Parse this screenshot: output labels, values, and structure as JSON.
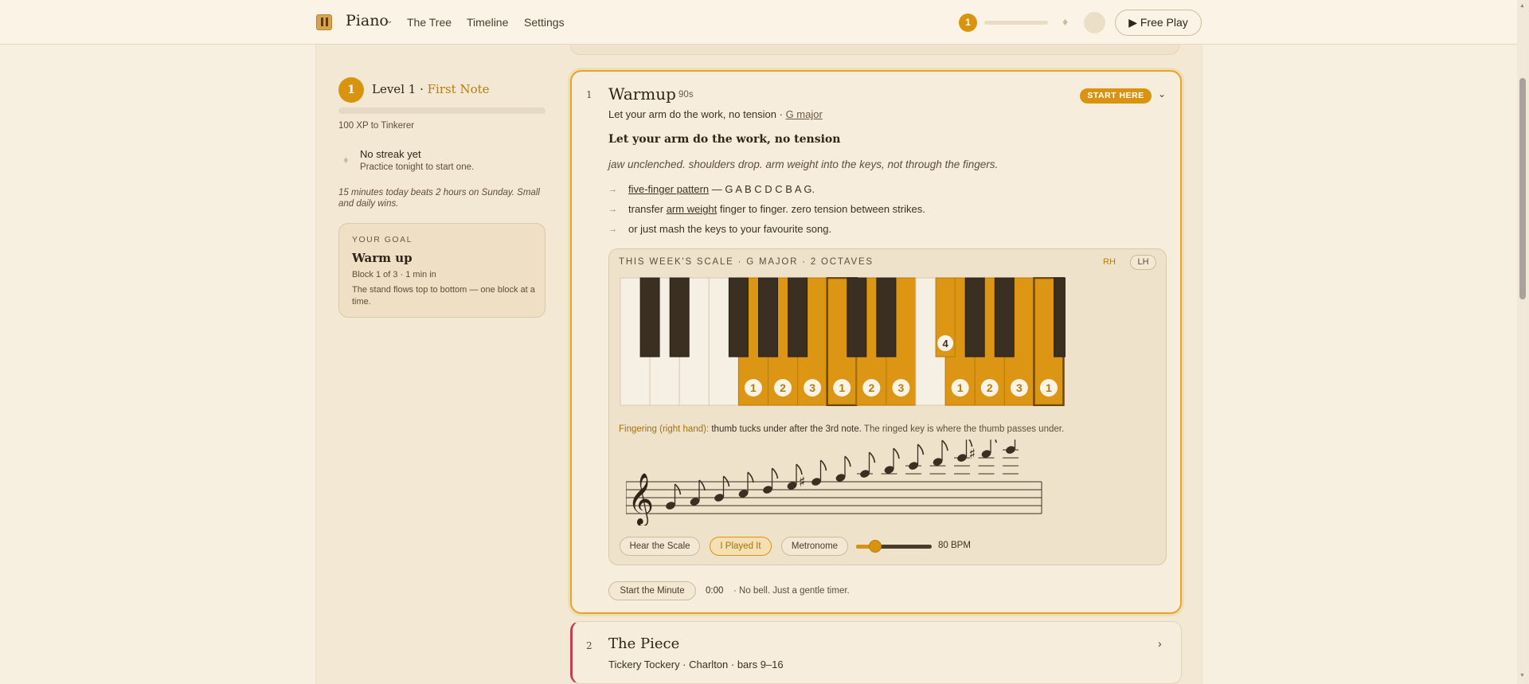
{
  "topbar": {
    "brand": "Piano",
    "nav": [
      "The Tree",
      "Timeline",
      "Settings"
    ],
    "xp_level": "1",
    "xp_progress": 0,
    "free_play_label": "▶ Free Play"
  },
  "sidebar": {
    "level_number": "1",
    "level_text": "Level 1 · ",
    "level_name": "First Note",
    "level_progress": 0,
    "xp_to_next": "100 XP to Tinkerer",
    "streak_title": "No streak yet",
    "streak_sub": "Practice tonight to start one.",
    "tip": "15 minutes today beats 2 hours on Sunday. Small and daily wins.",
    "goal": {
      "label": "YOUR GOAL",
      "title": "Warm up",
      "meta": "Block 1 of 3 · 1 min in",
      "desc": "The stand flows top to bottom — one block at a time."
    }
  },
  "warmup": {
    "num": "1",
    "title": "Warmup",
    "duration": "· 90s",
    "badge": "START HERE",
    "sub_text": "Let your arm do the work, no tension  · ",
    "sub_key": "G major",
    "cue": "Let your arm do the work, no tension",
    "cue_italic": "jaw unclenched. shoulders drop. arm weight into the keys, not through the fingers.",
    "bullets": [
      {
        "u": "five-finger pattern",
        "rest": " — G A B C D C B A G."
      },
      {
        "pre": "transfer ",
        "u": "arm weight",
        "rest": " finger to finger. zero tension between strikes."
      },
      {
        "pre": "or just mash the keys to your favourite song."
      }
    ],
    "scale": {
      "label": "THIS WEEK'S SCALE · G MAJOR · 2 OCTAVES",
      "rh": "RH",
      "lh": "LH",
      "keys": [
        {
          "hl": false,
          "ring": false,
          "finger": ""
        },
        {
          "hl": false,
          "ring": false,
          "finger": ""
        },
        {
          "hl": false,
          "ring": false,
          "finger": ""
        },
        {
          "hl": false,
          "ring": false,
          "finger": ""
        },
        {
          "hl": true,
          "ring": false,
          "finger": "1"
        },
        {
          "hl": true,
          "ring": false,
          "finger": "2"
        },
        {
          "hl": true,
          "ring": false,
          "finger": "3"
        },
        {
          "hl": true,
          "ring": true,
          "finger": "1"
        },
        {
          "hl": true,
          "ring": false,
          "finger": "2"
        },
        {
          "hl": true,
          "ring": false,
          "finger": "3"
        },
        {
          "hl": false,
          "ring": false,
          "finger": ""
        },
        {
          "hl": true,
          "ring": false,
          "finger": "1"
        },
        {
          "hl": true,
          "ring": false,
          "finger": "2"
        },
        {
          "hl": true,
          "ring": false,
          "finger": "3"
        },
        {
          "hl": true,
          "ring": true,
          "finger": "1"
        }
      ],
      "sharp_finger": "4",
      "fingering_label": "Fingering (right hand):",
      "fingering_main": " thumb tucks under after the 3rd note.",
      "fingering_note": " The ringed key is where the thumb passes under.",
      "staff_notes": [
        "G",
        "A",
        "B",
        "C",
        "D",
        "E",
        "F#",
        "G",
        "A",
        "B",
        "C",
        "D",
        "E",
        "F#",
        "G"
      ]
    },
    "controls": {
      "hear": "Hear the Scale",
      "played": "I Played It",
      "metronome": "Metronome",
      "bpm_value": 80,
      "bpm_min": 40,
      "bpm_max": 200,
      "bpm_text": "80 BPM"
    },
    "minute": {
      "button": "Start the Minute",
      "time": "0:00",
      "note": "· No bell. Just a gentle timer."
    }
  },
  "piece": {
    "num": "2",
    "title": "The Piece",
    "sub": "Tickery Tockery · Charlton · bars 9–16"
  },
  "colors": {
    "accent": "#d9940f",
    "key_highlight": "#dc9613",
    "piece_marker": "#c1404f"
  },
  "icons": {
    "brand_caret": "chevron-down-icon",
    "streak": "flame-icon",
    "card_caret": "chevron-down-icon",
    "piece_chevron": "chevron-right-icon"
  }
}
